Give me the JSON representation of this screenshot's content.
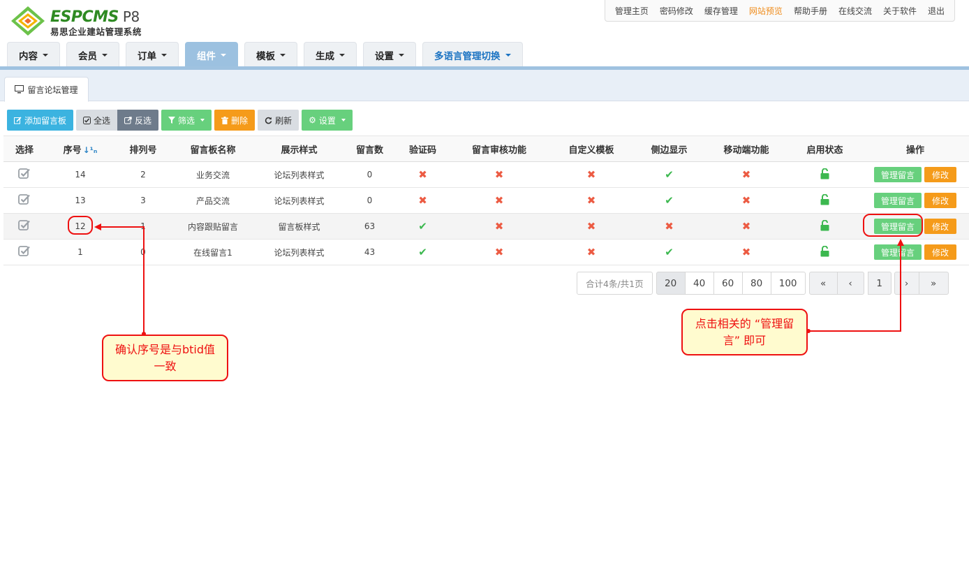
{
  "app": {
    "brand": "ESPCMS",
    "version": "P8",
    "subtitle": "易思企业建站管理系统"
  },
  "toplinks": [
    {
      "label": "管理主页",
      "active": false
    },
    {
      "label": "密码修改",
      "active": false
    },
    {
      "label": "缓存管理",
      "active": false
    },
    {
      "label": "网站预览",
      "active": true
    },
    {
      "label": "帮助手册",
      "active": false
    },
    {
      "label": "在线交流",
      "active": false
    },
    {
      "label": "关于软件",
      "active": false
    },
    {
      "label": "退出",
      "active": false
    }
  ],
  "menu": [
    {
      "label": "内容"
    },
    {
      "label": "会员"
    },
    {
      "label": "订单"
    },
    {
      "label": "组件",
      "active": true
    },
    {
      "label": "模板"
    },
    {
      "label": "生成"
    },
    {
      "label": "设置"
    },
    {
      "label": "多语言管理切换",
      "lang": true
    }
  ],
  "subtab": {
    "label": "留言论坛管理"
  },
  "toolbar": {
    "add": "添加留言板",
    "select_all": "全选",
    "invert": "反选",
    "filter": "筛选",
    "delete": "删除",
    "refresh": "刷新",
    "settings": "设置"
  },
  "table": {
    "headers": [
      "选择",
      "序号",
      "排列号",
      "留言板名称",
      "展示样式",
      "留言数",
      "验证码",
      "留言审核功能",
      "自定义模板",
      "侧边显示",
      "移动端功能",
      "启用状态",
      "操作"
    ],
    "rows": [
      {
        "id": "14",
        "order": "2",
        "name": "业务交流",
        "style": "论坛列表样式",
        "style_color": "red",
        "count": "0",
        "captcha": false,
        "review": false,
        "custom_tpl": false,
        "side": true,
        "mobile": false
      },
      {
        "id": "13",
        "order": "3",
        "name": "产品交流",
        "style": "论坛列表样式",
        "style_color": "red",
        "count": "0",
        "captcha": false,
        "review": false,
        "custom_tpl": false,
        "side": true,
        "mobile": false
      },
      {
        "id": "12",
        "order": "1",
        "name": "内容跟贴留言",
        "style": "留言板样式",
        "style_color": "green",
        "count": "63",
        "captcha": true,
        "review": false,
        "custom_tpl": false,
        "side": false,
        "mobile": false
      },
      {
        "id": "1",
        "order": "0",
        "name": "在线留言1",
        "style": "论坛列表样式",
        "style_color": "red",
        "count": "43",
        "captcha": true,
        "review": false,
        "custom_tpl": false,
        "side": true,
        "mobile": false
      }
    ],
    "action_manage": "管理留言",
    "action_edit": "修改"
  },
  "pager": {
    "info": "合计4条/共1页",
    "sizes": [
      "20",
      "40",
      "60",
      "80",
      "100"
    ],
    "active_size": "20",
    "current_page": "1"
  },
  "annotations": {
    "left": "确认序号是与btid值一致",
    "right": "点击相关的 “管理留言” 即可"
  },
  "colors": {
    "accent_blue": "#3bb3e0",
    "menu_active": "#9cc1e0",
    "green": "#67d07d",
    "orange": "#f59b1a",
    "annotation_red": "#ee1111"
  }
}
